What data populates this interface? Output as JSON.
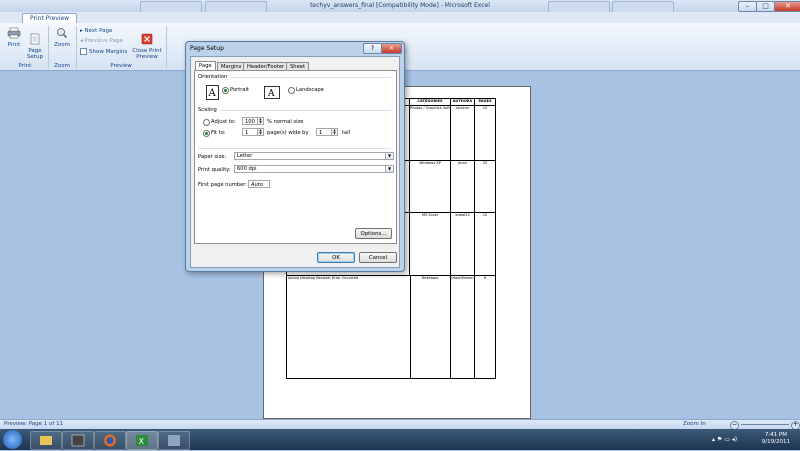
{
  "window": {
    "title": "techyv_answers_final  [Compatibility Mode]  -  Microsoft Excel"
  },
  "ribbon": {
    "tab": "Print Preview",
    "print": "Print",
    "page_setup": "Page\nSetup",
    "zoom": "Zoom",
    "next_page": "Next Page",
    "previous_page": "Previous Page",
    "show_margins": "Show Margins",
    "close_print_preview": "Close Print\nPreview",
    "groups": {
      "print": "Print",
      "zoom": "Zoom",
      "preview": "Preview"
    }
  },
  "document": {
    "headers": [
      "CATEGORIES",
      "AUTHORS",
      "PAGES"
    ],
    "rows": [
      {
        "title": "",
        "category": "Photos / Graphics Soft",
        "author": "skumar",
        "pages": "10"
      },
      {
        "title": "",
        "category": "Windows XP",
        "author": "jman",
        "pages": "25"
      },
      {
        "title": "",
        "category": "MS Excel",
        "author": "xdeal23",
        "pages": "10"
      },
      {
        "title": "Active Desktop Recover Error Occurred",
        "category": "Desktops",
        "author": "JHashMohan",
        "pages": "6"
      }
    ]
  },
  "dialog": {
    "title": "Page Setup",
    "help": "?",
    "close": "✕",
    "tabs": [
      "Page",
      "Margins",
      "Header/Footer",
      "Sheet"
    ],
    "orientation": {
      "label": "Orientation",
      "portrait": "Portrait",
      "landscape": "Landscape"
    },
    "scaling": {
      "label": "Scaling",
      "adjust_to": "Adjust to:",
      "adjust_value": "100",
      "normal_size": "% normal size",
      "fit_to": "Fit to:",
      "fit_wide": "1",
      "pages_wide_by": "page(s) wide by",
      "fit_tall": "1",
      "tall": "tall"
    },
    "paper_size": {
      "label": "Paper size:",
      "value": "Letter"
    },
    "print_quality": {
      "label": "Print quality:",
      "value": "600 dpi"
    },
    "first_page_number": {
      "label": "First page number:",
      "value": "Auto"
    },
    "options": "Options...",
    "ok": "OK",
    "cancel": "Cancel"
  },
  "status": {
    "left": "Preview: Page 1 of 11",
    "zoom_in": "Zoom In"
  },
  "clock": {
    "time": "7:41 PM",
    "date": "9/19/2011"
  }
}
